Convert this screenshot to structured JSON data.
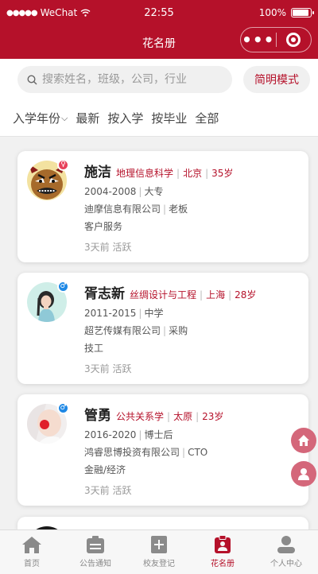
{
  "status_bar": {
    "carrier": "WeChat",
    "time": "22:55",
    "battery": "100%"
  },
  "nav": {
    "title": "花名册"
  },
  "search": {
    "placeholder": "搜索姓名，班级，公司，行业",
    "mode_button": "简明模式"
  },
  "filters": [
    {
      "label": "入学年份",
      "chevron": "⌵"
    },
    {
      "label": "最新"
    },
    {
      "label": "按入学"
    },
    {
      "label": "按毕业"
    },
    {
      "label": "全部"
    }
  ],
  "alumni": [
    {
      "name": "施洁",
      "major": "地理信息科学",
      "city": "北京",
      "age": "35岁",
      "years": "2004-2008",
      "degree": "大专",
      "company": "迪摩信息有限公司",
      "position": "老板",
      "industry": "客户服务",
      "activity": "3天前 活跃",
      "gender": "female",
      "gender_icon": "♀"
    },
    {
      "name": "胥志新",
      "major": "丝绸设计与工程",
      "city": "上海",
      "age": "28岁",
      "years": "2011-2015",
      "degree": "中学",
      "company": "超艺传媒有限公司",
      "position": "采购",
      "industry": "技工",
      "activity": "3天前 活跃",
      "gender": "male",
      "gender_icon": "♂"
    },
    {
      "name": "管勇",
      "major": "公共关系学",
      "city": "太原",
      "age": "23岁",
      "years": "2016-2020",
      "degree": "博士后",
      "company": "鸿睿思博投资有限公司",
      "position": "CTO",
      "industry": "金融/经济",
      "activity": "3天前 活跃",
      "gender": "male",
      "gender_icon": "♂"
    }
  ],
  "tabbar": [
    {
      "label": "首页",
      "icon": "home-icon"
    },
    {
      "label": "公告通知",
      "icon": "notice-icon"
    },
    {
      "label": "校友登记",
      "icon": "register-icon"
    },
    {
      "label": "花名册",
      "icon": "roster-icon",
      "active": true
    },
    {
      "label": "个人中心",
      "icon": "profile-icon"
    }
  ],
  "colors": {
    "brand": "#b5112a",
    "female_badge": "#e8405a",
    "male_badge": "#1e88e5",
    "fab": "#d4677a"
  }
}
